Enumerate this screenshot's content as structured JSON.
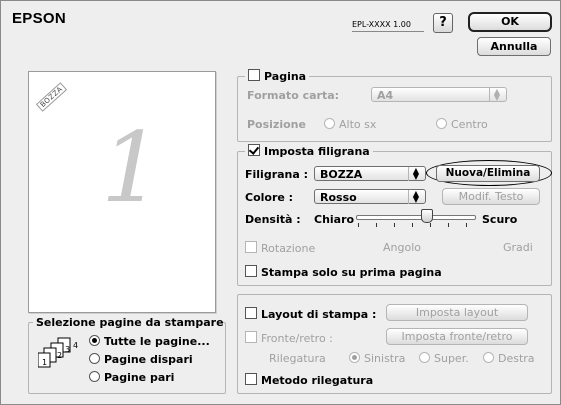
{
  "header": {
    "brand": "EPSON",
    "model": "EPL-XXXX 1.00",
    "help_label": "?",
    "ok_label": "OK",
    "cancel_label": "Annulla"
  },
  "preview": {
    "stamp_text": "BOZZA",
    "page_number": "1"
  },
  "page_selection": {
    "title": "Selezione pagine da stampare",
    "options": [
      "Tutte le pagine...",
      "Pagine dispari",
      "Pagine pari"
    ],
    "selected": "Tutte le pagine..."
  },
  "pagina": {
    "title": "Pagina",
    "checked": false,
    "paper_label": "Formato carta:",
    "paper_value": "A4",
    "position_label": "Posizione",
    "position_options": [
      "Alto sx",
      "Centro"
    ]
  },
  "watermark": {
    "title": "Imposta filigrana",
    "checked": true,
    "filigrana_label": "Filigrana :",
    "filigrana_value": "BOZZA",
    "new_delete_label": "Nuova/Elimina",
    "colore_label": "Colore :",
    "colore_value": "Rosso",
    "edit_text_label": "Modif. Testo",
    "densita_label": "Densità :",
    "chiaro_label": "Chiaro",
    "scuro_label": "Scuro",
    "density_level": 0.6,
    "rotation_label": "Rotazione",
    "angle_label": "Angolo",
    "degrees_label": "Gradi",
    "first_page_label": "Stampa solo su prima pagina"
  },
  "layout": {
    "layout_label": "Layout di stampa :",
    "layout_button": "Imposta layout",
    "duplex_label": "Fronte/retro :",
    "duplex_button": "Imposta fronte/retro",
    "binding_label": "Rilegatura",
    "binding_options": [
      "Sinistra",
      "Super.",
      "Destra"
    ],
    "binding_selected": "Sinistra",
    "binding_method_label": "Metodo rilegatura"
  },
  "colors": {
    "window_bg": "#eeeeee",
    "disabled_text": "#a0a0a0"
  }
}
